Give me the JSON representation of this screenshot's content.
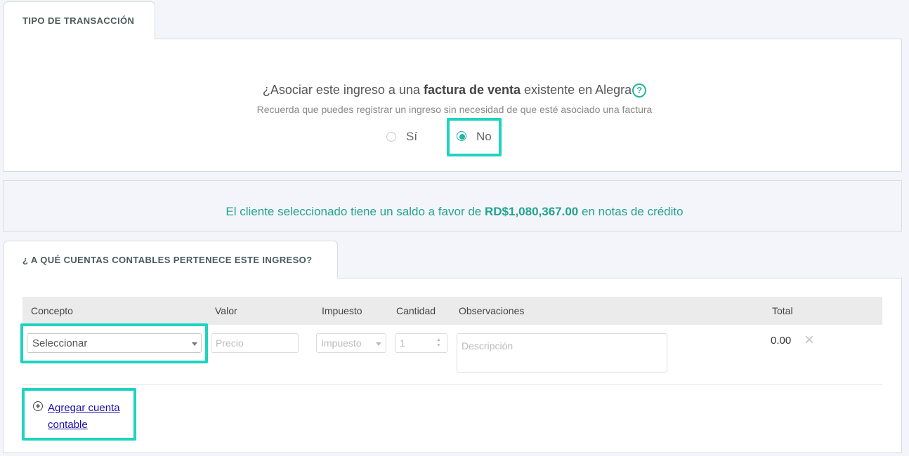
{
  "transaction_tab": {
    "label": "TIPO DE TRANSACCIÓN"
  },
  "association": {
    "question_prefix": "¿Asociar este ingreso a una ",
    "question_bold": "factura de venta",
    "question_suffix": " existente en Alegra",
    "help_icon": "?",
    "hint": "Recuerda que puedes registrar un ingreso sin necesidad de que esté asociado una factura",
    "options": [
      {
        "label": "Sí",
        "selected": false
      },
      {
        "label": "No",
        "selected": true
      }
    ]
  },
  "credit_banner": {
    "prefix": "El cliente seleccionado tiene un saldo a favor de ",
    "amount": "RD$1,080,367.00",
    "suffix": " en notas de crédito"
  },
  "accounts_tab": {
    "label": "¿ A QUÉ CUENTAS CONTABLES PERTENECE ESTE INGRESO?"
  },
  "table": {
    "headers": {
      "concept": "Concepto",
      "value": "Valor",
      "tax": "Impuesto",
      "quantity": "Cantidad",
      "notes": "Observaciones",
      "total": "Total"
    },
    "row": {
      "concept_select": "Seleccionar",
      "price_placeholder": "Precio",
      "tax_select": "Impuesto",
      "quantity": "1",
      "description_placeholder": "Descripción",
      "total": "0.00",
      "delete_icon": "×"
    }
  },
  "add_account": {
    "icon": "+",
    "label_line1": "Agregar cuenta",
    "label_line2": "contable"
  },
  "colors": {
    "accent": "#21b6a1",
    "highlight": "#1ed3c0",
    "link": "#1a0dab"
  }
}
